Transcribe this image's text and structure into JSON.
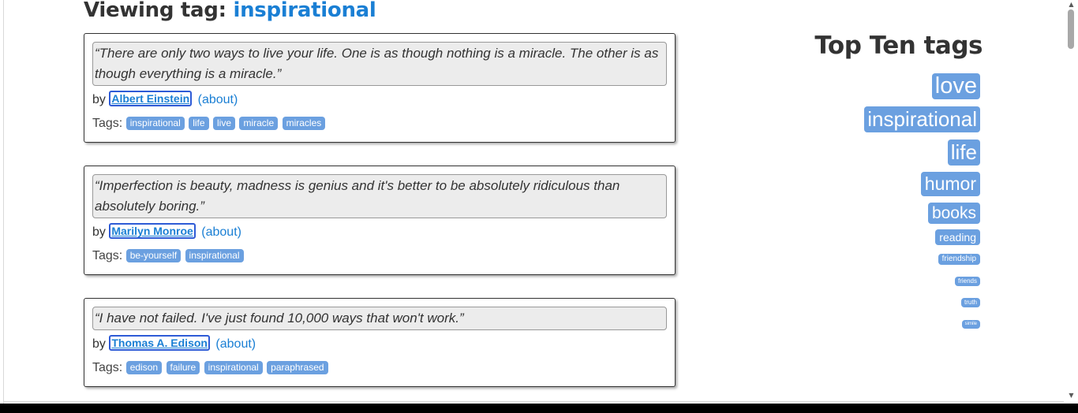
{
  "heading": {
    "prefix": "Viewing tag:",
    "tag": "inspirational"
  },
  "tags_label": "Tags:",
  "quotes": [
    {
      "text": "“There are only two ways to live your life. One is as though nothing is a miracle. The other is as though everything is a miracle.”",
      "by": "by",
      "author": "Albert Einstein",
      "about": "(about)",
      "tags": [
        "inspirational",
        "life",
        "live",
        "miracle",
        "miracles"
      ]
    },
    {
      "text": "“Imperfection is beauty, madness is genius and it's better to be absolutely ridiculous than absolutely boring.”",
      "by": "by",
      "author": "Marilyn Monroe",
      "about": "(about)",
      "tags": [
        "be-yourself",
        "inspirational"
      ]
    },
    {
      "text": "“I have not failed. I've just found 10,000 ways that won't work.”",
      "by": "by",
      "author": "Thomas A. Edison",
      "about": "(about)",
      "tags": [
        "edison",
        "failure",
        "inspirational",
        "paraphrased"
      ]
    }
  ],
  "top_ten": {
    "title": "Top Ten tags",
    "tags": [
      "love",
      "inspirational",
      "life",
      "humor",
      "books",
      "reading",
      "friendship",
      "friends",
      "truth",
      "simile"
    ]
  },
  "colors": {
    "accent": "#1a7fd4",
    "tag_bg": "#6ba0e0"
  }
}
